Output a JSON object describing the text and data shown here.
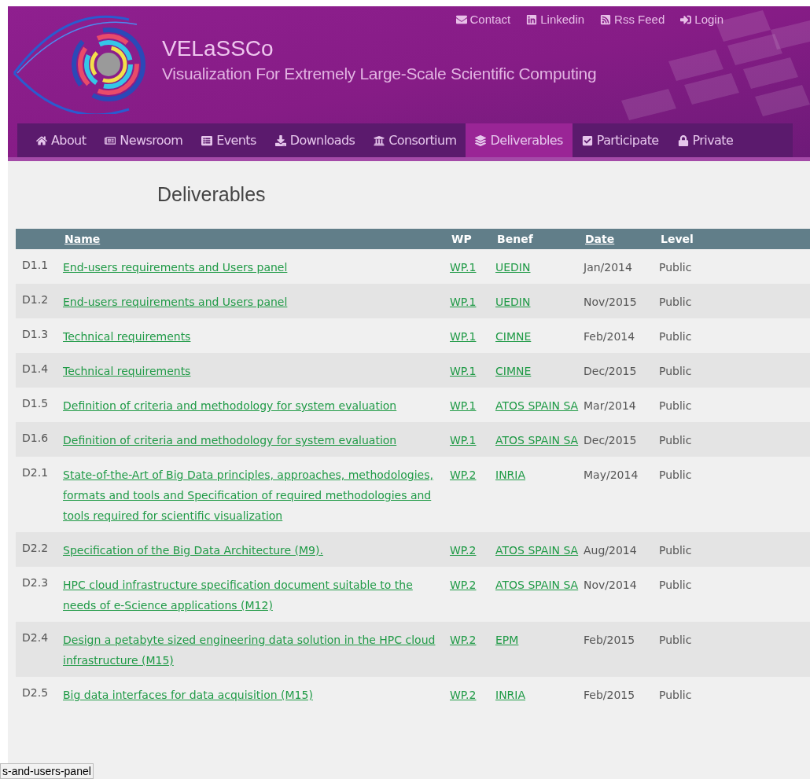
{
  "header": {
    "top_links": [
      {
        "kind": "contact",
        "label": "Contact"
      },
      {
        "kind": "linkedin",
        "label": "Linkedin"
      },
      {
        "kind": "rss",
        "label": "Rss Feed"
      },
      {
        "kind": "login",
        "label": "Login"
      }
    ],
    "site_name": "VELaSSCo",
    "tagline": "Visualization For Extremely Large-Scale Scientific Computing"
  },
  "nav": [
    {
      "kind": "home",
      "label": "About",
      "selected": false
    },
    {
      "kind": "news",
      "label": "Newsroom",
      "selected": false
    },
    {
      "kind": "events",
      "label": "Events",
      "selected": false
    },
    {
      "kind": "downloads",
      "label": "Downloads",
      "selected": false
    },
    {
      "kind": "consortium",
      "label": "Consortium",
      "selected": false
    },
    {
      "kind": "deliverables",
      "label": "Deliverables",
      "selected": true
    },
    {
      "kind": "participate",
      "label": "Participate",
      "selected": false
    },
    {
      "kind": "private",
      "label": "Private",
      "selected": false
    }
  ],
  "page_title": "Deliverables",
  "table": {
    "columns": [
      {
        "label": "Name",
        "sortable": true
      },
      {
        "label": "WP",
        "sortable": false
      },
      {
        "label": "Benef",
        "sortable": false
      },
      {
        "label": "Date",
        "sortable": true
      },
      {
        "label": "Level",
        "sortable": false
      }
    ],
    "rows": [
      {
        "code": "D1.1",
        "name": "End-users requirements and Users panel",
        "wp": "WP.1",
        "benef": "UEDIN",
        "date": "Jan/2014",
        "level": "Public"
      },
      {
        "code": "D1.2",
        "name": "End-users requirements and Users panel",
        "wp": "WP.1",
        "benef": "UEDIN",
        "date": "Nov/2015",
        "level": "Public"
      },
      {
        "code": "D1.3",
        "name": "Technical requirements",
        "wp": "WP.1",
        "benef": "CIMNE",
        "date": "Feb/2014",
        "level": "Public"
      },
      {
        "code": "D1.4",
        "name": "Technical requirements",
        "wp": "WP.1",
        "benef": "CIMNE",
        "date": "Dec/2015",
        "level": "Public"
      },
      {
        "code": "D1.5",
        "name": "Definition of criteria and methodology for system evaluation",
        "wp": "WP.1",
        "benef": "ATOS SPAIN SA",
        "date": "Mar/2014",
        "level": "Public"
      },
      {
        "code": "D1.6",
        "name": "Definition of criteria and methodology for system evaluation",
        "wp": "WP.1",
        "benef": "ATOS SPAIN SA",
        "date": "Dec/2015",
        "level": "Public"
      },
      {
        "code": "D2.1",
        "name": "State-of-the-Art of Big Data principles, approaches, methodologies, formats and tools and Specification of required methodologies and tools required for scientific visualization",
        "wp": "WP.2",
        "benef": "INRIA",
        "date": "May/2014",
        "level": "Public"
      },
      {
        "code": "D2.2",
        "name": "Specification of the Big Data Architecture (M9).",
        "wp": "WP.2",
        "benef": "ATOS SPAIN SA",
        "date": "Aug/2014",
        "level": "Public"
      },
      {
        "code": "D2.3",
        "name": "HPC cloud infrastructure specification document suitable to the needs of e-Science applications (M12)",
        "wp": "WP.2",
        "benef": "ATOS SPAIN SA",
        "date": "Nov/2014",
        "level": "Public"
      },
      {
        "code": "D2.4",
        "name": "Design a petabyte sized engineering data solution in the HPC cloud infrastructure (M15)",
        "wp": "WP.2",
        "benef": "EPM",
        "date": "Feb/2015",
        "level": "Public"
      },
      {
        "code": "D2.5",
        "name": "Big data interfaces for data acquisition (M15)",
        "wp": "WP.2",
        "benef": "INRIA",
        "date": "Feb/2015",
        "level": "Public"
      }
    ]
  },
  "status_bar": {
    "url": "s-and-users-panel"
  }
}
